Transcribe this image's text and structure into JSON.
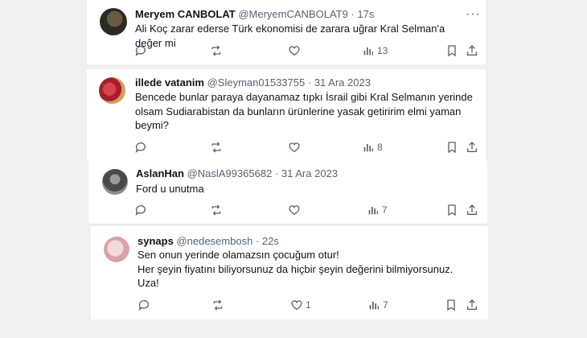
{
  "tweets": [
    {
      "name": "Meryem CANBOLAT",
      "handle": "@MeryemCANBOLAT9",
      "sep": "·",
      "time": "17s",
      "text": [
        "Ali Koç zarar ederse Türk ekonomisi de zarara uğrar Kral Selman'a değer mi"
      ],
      "reply_icon": "reply-icon",
      "retweet_icon": "retweet-icon",
      "like_icon": "like-icon",
      "views_icon": "views-icon",
      "views": "13",
      "likes": ""
    },
    {
      "name": "illede vatanim",
      "handle": "@Sleyman01533755",
      "sep": "·",
      "time": "31 Ara 2023",
      "text": [
        "Bencede bunlar paraya dayanamaz tıpkı İsrail gibi Kral Selmanın yerinde",
        "olsam Sudiarabistan da bunların ürünlerine yasak getiririm elmi yaman",
        "beymi?"
      ],
      "views": "8",
      "likes": ""
    },
    {
      "name": "AslanHan",
      "handle": "@NaslA99365682",
      "sep": "·",
      "time": "31 Ara 2023",
      "text": [
        "Ford u unutma"
      ],
      "views": "7",
      "likes": ""
    },
    {
      "name": "synaps",
      "handle": "@nedesembosh",
      "sep": "·",
      "time": "22s",
      "text": [
        "Sen onun yerinde olamazsın çocuğum otur!",
        "Her şeyin  fiyatını biliyorsunuz da hiçbir şeyin değerini bilmiyorsunuz.",
        "Uza!"
      ],
      "views": "7",
      "likes": "1"
    }
  ],
  "more_label": "···",
  "colors": {
    "text": "#0f1419",
    "muted": "#536471",
    "background": "#f0f0f0"
  }
}
